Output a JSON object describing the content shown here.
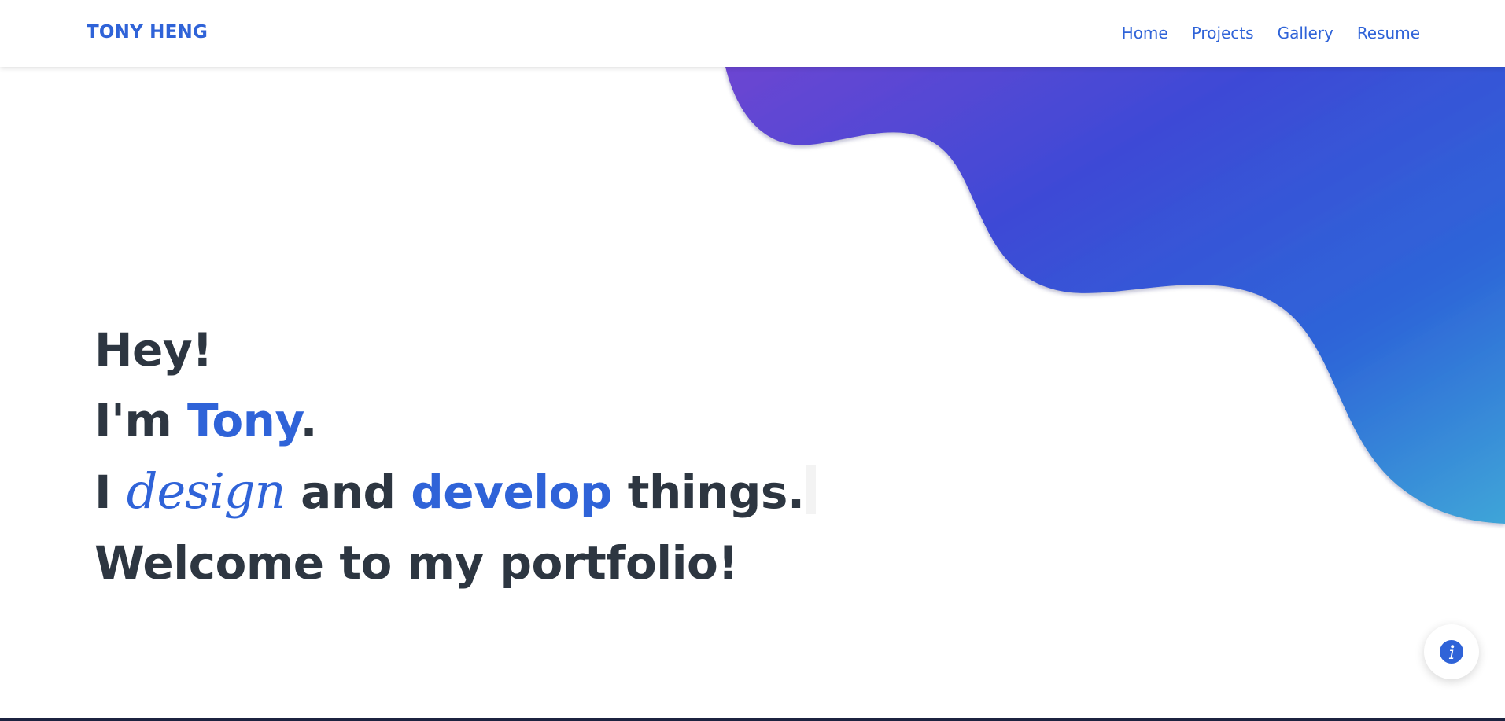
{
  "navbar": {
    "brand": "TONY HENG",
    "links": [
      "Home",
      "Projects",
      "Gallery",
      "Resume"
    ]
  },
  "hero": {
    "line1": "Hey!",
    "line2_prefix": "I'm ",
    "line2_name": "Tony",
    "line2_suffix": ".",
    "line3_prefix": "I ",
    "line3_script": "design",
    "line3_middle": " and ",
    "line3_accent": "develop",
    "line3_suffix": " things.",
    "line4": "Welcome to my portfolio!"
  },
  "info_button": {
    "icon": "info-icon"
  },
  "colors": {
    "accent": "#2f63d8",
    "text": "#2d3641",
    "blob_start": "#6c45d2",
    "blob_mid": "#3d4ad6",
    "blob_end": "#3b9fd8"
  }
}
